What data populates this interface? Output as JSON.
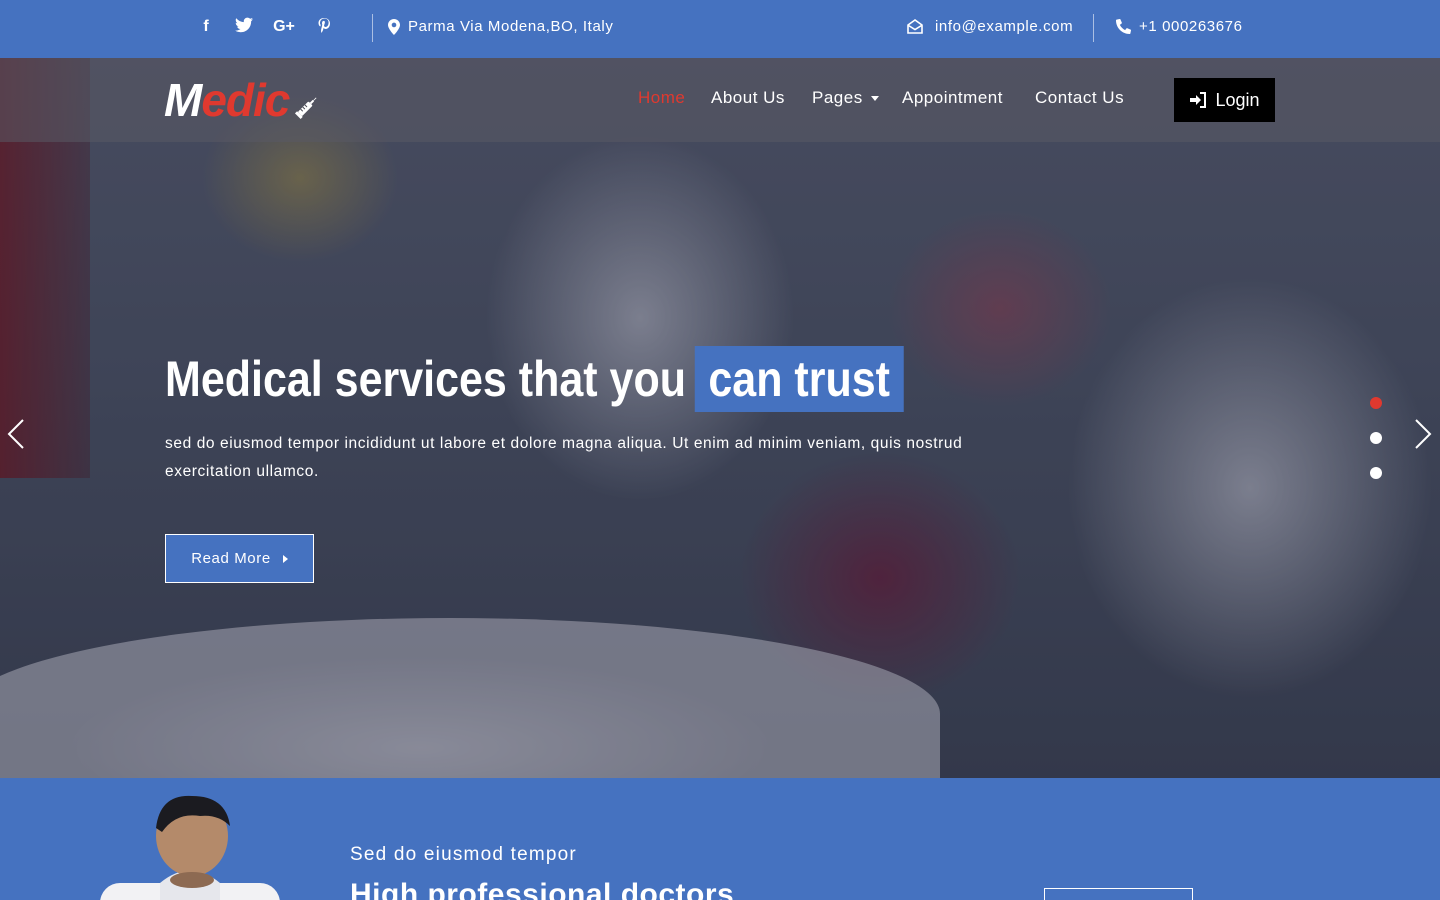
{
  "topbar": {
    "social": [
      "f",
      "t",
      "G+",
      "P"
    ],
    "address": "Parma Via Modena,BO, Italy",
    "email": "info@example.com",
    "phone": "+1 000263676"
  },
  "brand": {
    "logo_first": "M",
    "logo_rest": "edic"
  },
  "nav": {
    "items": [
      "Home",
      "About Us",
      "Pages",
      "Appointment",
      "Contact Us"
    ],
    "active_index": 0,
    "login": "Login"
  },
  "hero": {
    "headline": "Medical services that you",
    "headline_highlight": "can trust",
    "subtext": "sed do eiusmod tempor incididunt ut labore et dolore magna aliqua. Ut enim ad minim veniam, quis nostrud exercitation ullamco.",
    "cta": "Read More",
    "slides": 3,
    "active_slide": 1
  },
  "section": {
    "kicker": "Sed do eiusmod tempor",
    "title": "High professional doctors"
  },
  "colors": {
    "primary": "#4572c0",
    "accent": "#e0392f",
    "button_dark": "#000000"
  }
}
